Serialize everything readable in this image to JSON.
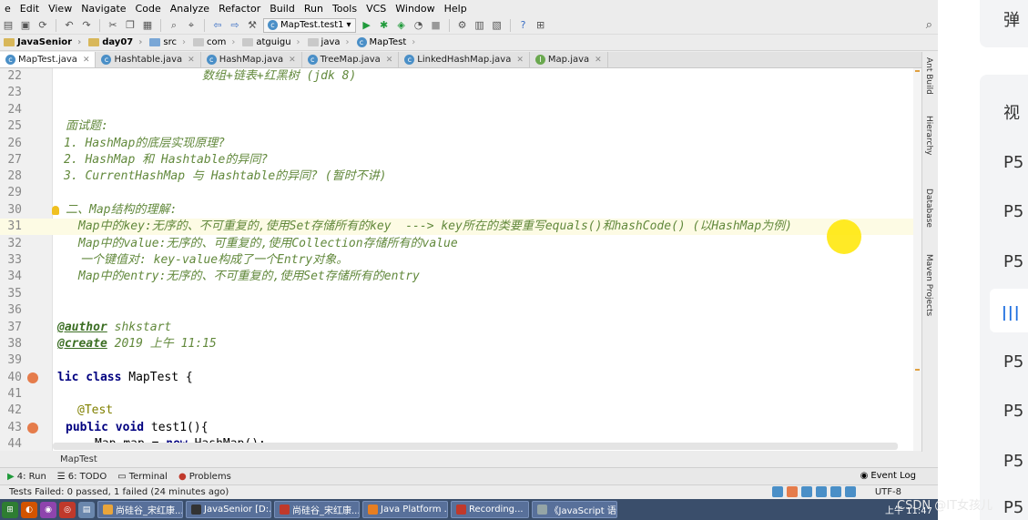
{
  "menu": [
    "e",
    "Edit",
    "View",
    "Navigate",
    "Code",
    "Analyze",
    "Refactor",
    "Build",
    "Run",
    "Tools",
    "VCS",
    "Window",
    "Help"
  ],
  "toolbar": {
    "run_config": "MapTest.test1"
  },
  "breadcrumb": [
    "JavaSenior",
    "day07",
    "src",
    "com",
    "atguigu",
    "java",
    "MapTest"
  ],
  "tabs": [
    "MapTest.java",
    "Hashtable.java",
    "HashMap.java",
    "TreeMap.java",
    "LinkedHashMap.java",
    "Map.java"
  ],
  "editor": {
    "lines": [
      {
        "n": "22",
        "text": "数组+链表+红黑树 (jdk 8)"
      },
      {
        "n": "23",
        "text": ""
      },
      {
        "n": "24",
        "text": ""
      },
      {
        "n": "25",
        "text": "面试题:"
      },
      {
        "n": "26",
        "text": "1. HashMap的底层实现原理?"
      },
      {
        "n": "27",
        "text": "2. HashMap 和 Hashtable的异同?"
      },
      {
        "n": "28",
        "text": "3. CurrentHashMap 与 Hashtable的异同? (暂时不讲)"
      },
      {
        "n": "29",
        "text": ""
      },
      {
        "n": "30",
        "text": "二、Map结构的理解:"
      },
      {
        "n": "31",
        "text": "Map中的key:无序的、不可重复的,使用Set存储所有的key  ---> key所在的类要重写equals()和hashCode() (以HashMap为例)"
      },
      {
        "n": "32",
        "text": "Map中的value:无序的、可重复的,使用Collection存储所有的value"
      },
      {
        "n": "33",
        "text": "一个键值对: key-value构成了一个Entry对象。"
      },
      {
        "n": "34",
        "text": "Map中的entry:无序的、不可重复的,使用Set存储所有的entry"
      },
      {
        "n": "35",
        "text": ""
      },
      {
        "n": "36",
        "text": ""
      },
      {
        "n": "37",
        "tag": "@author",
        "text": " shkstart"
      },
      {
        "n": "38",
        "tag": "@create",
        "text": " 2019 上午 11:15"
      },
      {
        "n": "39",
        "text": ""
      },
      {
        "n": "40",
        "kw": "lic class",
        "text": " MapTest {"
      },
      {
        "n": "41",
        "text": ""
      },
      {
        "n": "42",
        "anno": "@Test"
      },
      {
        "n": "43",
        "kw": "public void",
        "text": " test1(){"
      },
      {
        "n": "44",
        "pre": "Map ",
        "var": "map",
        "post": " = ",
        "kw2": "new",
        "post2": " HashMap();"
      }
    ]
  },
  "file_crumb": "MapTest",
  "bottom_tabs": [
    "4: Run",
    "6: TODO",
    "Terminal",
    "Problems"
  ],
  "event_log": "Event Log",
  "status": {
    "message": "Tests Failed: 0 passed, 1 failed (24 minutes ago)",
    "encoding": "UTF-8"
  },
  "taskbar": {
    "tasks": [
      "尚硅谷_宋红康...",
      "JavaSenior [D:...",
      "尚硅谷_宋红康...",
      "Java Platform ...",
      "Recording...",
      "《JavaScript 语言参考..."
    ],
    "clock": "上午 11:47"
  },
  "toolwindows_right": [
    "Ant Build",
    "Hierarchy",
    "Database",
    "Maven Projects"
  ],
  "side_panel": {
    "top": "弹",
    "items": [
      "视",
      "P5",
      "P5",
      "P5",
      "P5",
      "P5",
      "P5",
      "P5"
    ]
  },
  "watermark": "CSDN @IT女孩儿"
}
